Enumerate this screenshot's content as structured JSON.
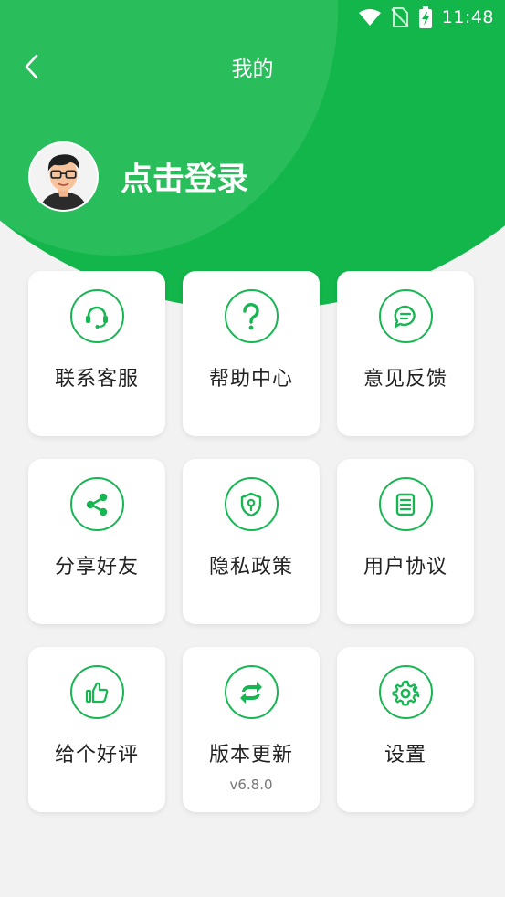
{
  "status_bar": {
    "time": "11:48"
  },
  "header": {
    "title": "我的"
  },
  "profile": {
    "login_label": "点击登录"
  },
  "menu": [
    {
      "label": "联系客服",
      "icon": "headset-icon"
    },
    {
      "label": "帮助中心",
      "icon": "question-icon"
    },
    {
      "label": "意见反馈",
      "icon": "chat-bubble-icon"
    },
    {
      "label": "分享好友",
      "icon": "share-icon"
    },
    {
      "label": "隐私政策",
      "icon": "shield-icon"
    },
    {
      "label": "用户协议",
      "icon": "document-icon"
    },
    {
      "label": "给个好评",
      "icon": "thumbs-up-icon"
    },
    {
      "label": "版本更新",
      "icon": "refresh-icon",
      "sub": "v6.8.0"
    },
    {
      "label": "设置",
      "icon": "gear-icon"
    }
  ],
  "colors": {
    "accent": "#12b64a",
    "icon_green": "#18b653",
    "background": "#f2f2f2"
  }
}
